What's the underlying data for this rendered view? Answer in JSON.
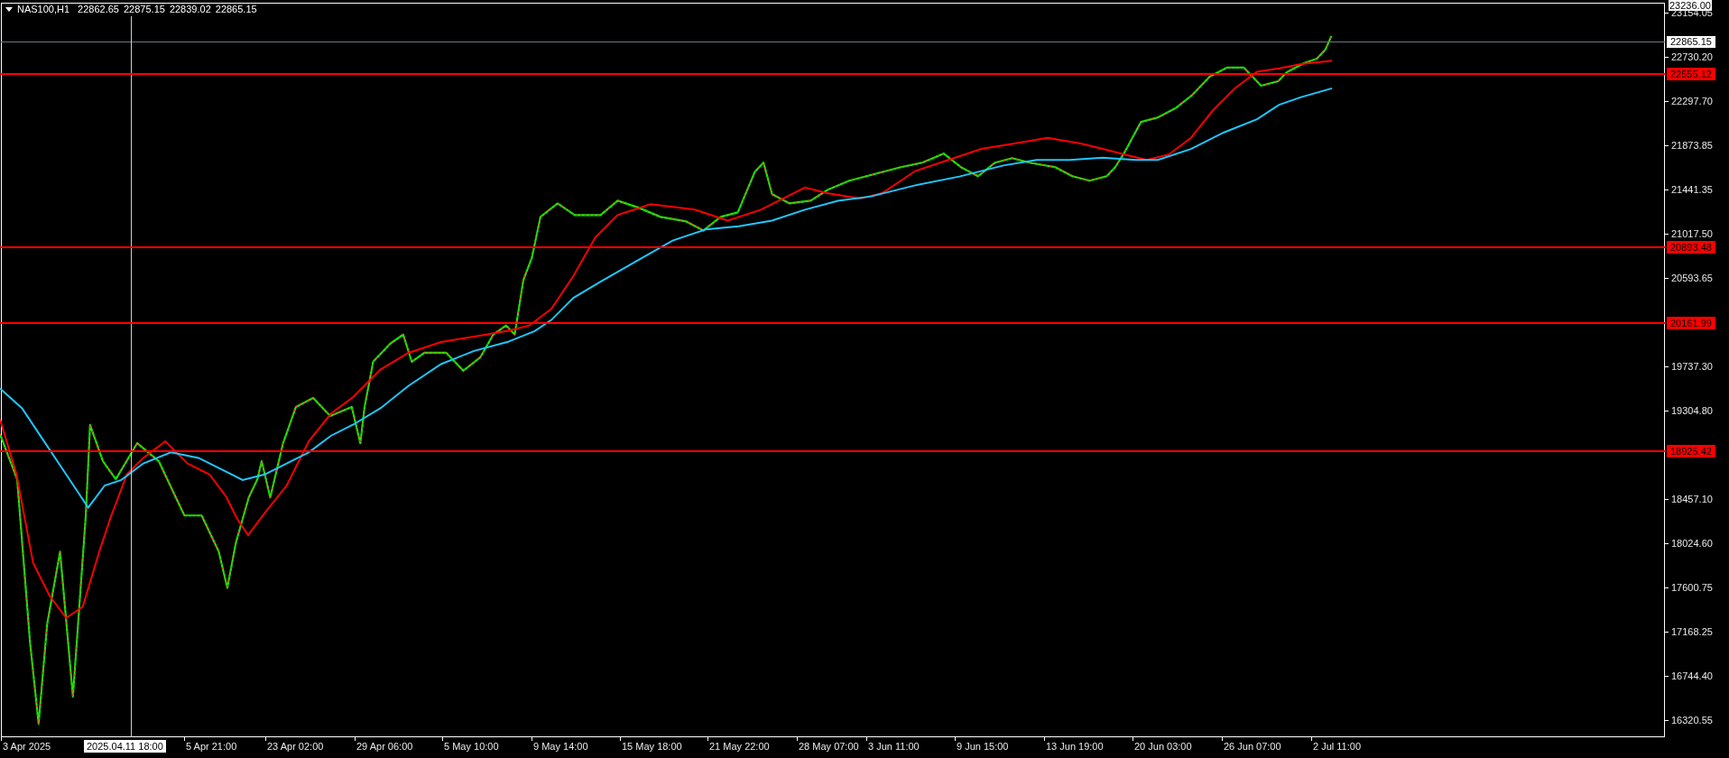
{
  "header": {
    "symbol": "NAS100,H1",
    "prices": [
      "22862.65",
      "22875.15",
      "22839.02",
      "22865.15"
    ]
  },
  "price_axis": {
    "top_label": "23236.00",
    "ticks": [
      "23154.05",
      "22730.20",
      "22297.70",
      "21873.85",
      "21441.35",
      "21017.50",
      "20593.65",
      "19737.30",
      "19304.80",
      "18457.10",
      "18024.60",
      "17600.75",
      "17168.25",
      "16744.40",
      "16320.55"
    ],
    "current_price": "22865.15",
    "levels": [
      "22555.12",
      "20893.48",
      "20161.99",
      "18925.42"
    ]
  },
  "time_axis": {
    "labels": [
      "3 Apr 2025",
      "5 Apr 21:00",
      "23 Apr 02:00",
      "29 Apr 06:00",
      "5 May 10:00",
      "9 May 14:00",
      "15 May 18:00",
      "21 May 22:00",
      "28 May 07:00",
      "3 Jun 11:00",
      "9 Jun 15:00",
      "13 Jun 19:00",
      "20 Jun 03:00",
      "26 Jun 07:00",
      "2 Jul 11:00"
    ],
    "crosshair_label": "2025.04.11 18:00"
  }
}
